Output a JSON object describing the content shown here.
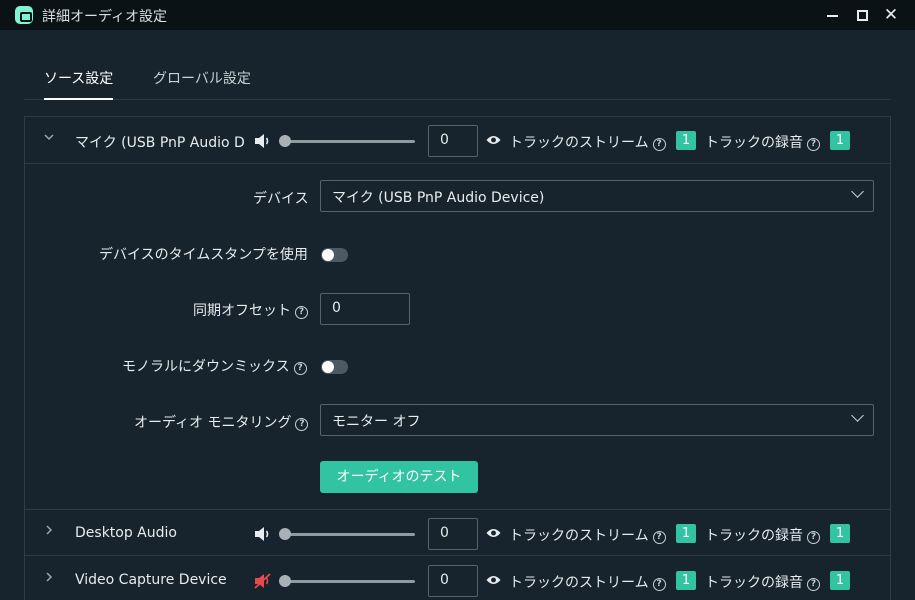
{
  "window": {
    "title": "詳細オーディオ設定",
    "min_icon": "minimize-icon",
    "max_icon": "maximize-icon",
    "close_label": "✕"
  },
  "tabs": [
    {
      "label": "ソース設定",
      "active": true
    },
    {
      "label": "グローバル設定",
      "active": false
    }
  ],
  "sources": [
    {
      "name": "マイク (USB PnP Audio D...",
      "expanded": true,
      "muted": false,
      "volume": "0",
      "stream_label": "トラックのストリーム",
      "stream_track": "1",
      "record_label": "トラックの録音",
      "record_track": "1"
    },
    {
      "name": "Desktop Audio",
      "expanded": false,
      "muted": false,
      "volume": "0",
      "stream_label": "トラックのストリーム",
      "stream_track": "1",
      "record_label": "トラックの録音",
      "record_track": "1"
    },
    {
      "name": "Video Capture Device",
      "expanded": false,
      "muted": true,
      "volume": "0",
      "stream_label": "トラックのストリーム",
      "stream_track": "1",
      "record_label": "トラックの録音",
      "record_track": "1"
    }
  ],
  "details": {
    "device_label": "デバイス",
    "device_value": "マイク (USB PnP Audio Device)",
    "timestamp_label": "デバイスのタイムスタンプを使用",
    "timestamp_on": false,
    "sync_label": "同期オフセット",
    "sync_value": "0",
    "mono_label": "モノラルにダウンミックス",
    "mono_on": false,
    "monitor_label": "オーディオ モニタリング",
    "monitor_value": "モニター オフ",
    "test_button": "オーディオのテスト"
  },
  "colors": {
    "accent": "#31c3a2",
    "background": "#17242d",
    "titlebar": "#0b1216",
    "muted_icon": "#e5484d"
  }
}
